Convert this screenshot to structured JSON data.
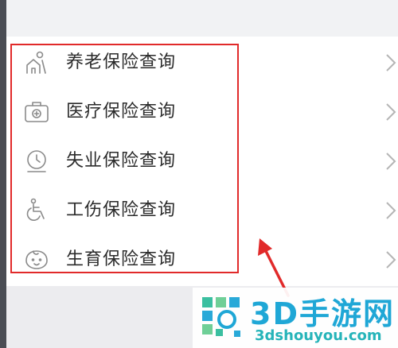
{
  "menu": {
    "items": [
      {
        "label": "养老保险查询",
        "icon": "elderly-person-icon"
      },
      {
        "label": "医疗保险查询",
        "icon": "medical-kit-icon"
      },
      {
        "label": "失业保险查询",
        "icon": "clock-icon"
      },
      {
        "label": "工伤保险查询",
        "icon": "wheelchair-icon"
      },
      {
        "label": "生育保险查询",
        "icon": "baby-icon"
      }
    ]
  },
  "watermark": {
    "title": "3D手游网",
    "url": "3dshouyou.com"
  },
  "colors": {
    "highlight_border": "#e12a2a",
    "icon_stroke": "#888888",
    "watermark_text": "#1fa7d6"
  }
}
